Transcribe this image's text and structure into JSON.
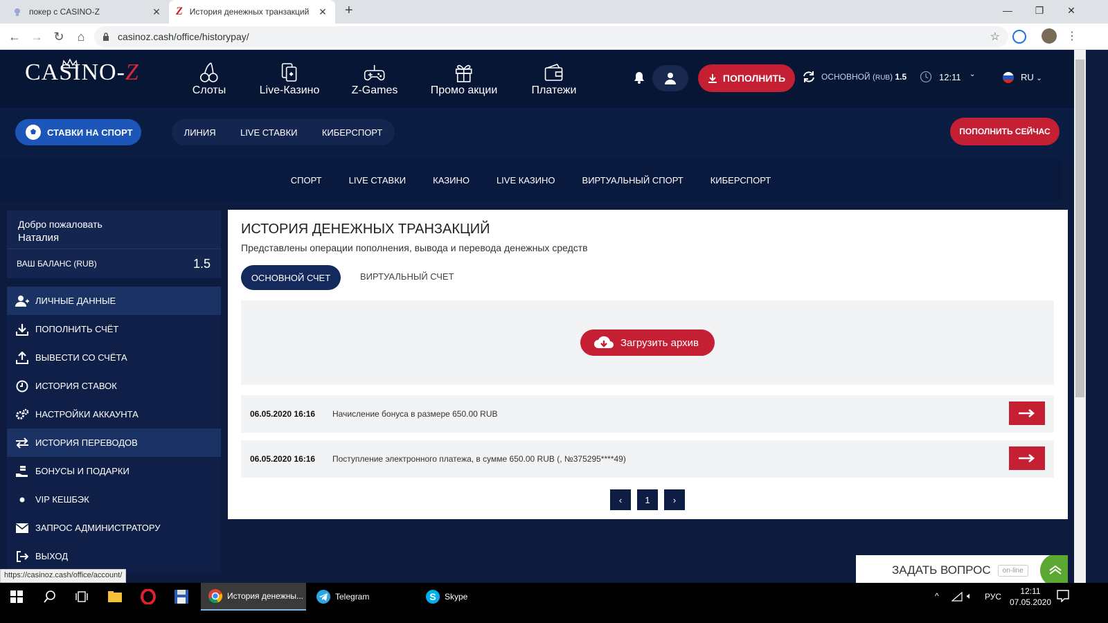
{
  "browser": {
    "tabs": [
      {
        "title": "покер с CASINO-Z"
      },
      {
        "title": "История денежных транзакций"
      }
    ],
    "url": "casinoz.cash/office/historypay/",
    "status_url": "https://casinoz.cash/office/account/"
  },
  "header": {
    "logo_text": "CASINO-",
    "logo_z": "Z",
    "nav": [
      {
        "label": "Слоты",
        "icon": "cherry-icon"
      },
      {
        "label": "Live-Казино",
        "icon": "cards-icon"
      },
      {
        "label": "Z-Games",
        "icon": "gamepad-icon"
      },
      {
        "label": "Промо акции",
        "icon": "gift-icon"
      },
      {
        "label": "Платежи",
        "icon": "wallet-icon"
      }
    ],
    "deposit_label": "ПОПОЛНИТЬ",
    "account_label": "ОСНОВНОЙ",
    "account_currency": "RUB",
    "account_balance": "1.5",
    "time": "12:11",
    "language": "RU"
  },
  "subnav": {
    "sports_label": "СТАВКИ НА СПОРТ",
    "links": [
      "ЛИНИЯ",
      "LIVE СТАВКИ",
      "КИБЕРСПОРТ"
    ],
    "deposit_now_label": "ПОПОЛНИТЬ СЕЙЧАС"
  },
  "categories": [
    "СПОРТ",
    "LIVE СТАВКИ",
    "КАЗИНО",
    "LIVE КАЗИНО",
    "ВИРТУАЛЬНЫЙ СПОРТ",
    "КИБЕРСПОРТ"
  ],
  "sidebar": {
    "welcome": "Добро пожаловать",
    "username": "Наталия",
    "balance_label": "ВАШ БАЛАНС (RUB)",
    "balance_value": "1.5",
    "menu": [
      {
        "label": "ЛИЧНЫЕ ДАННЫЕ",
        "icon": "user-add-icon"
      },
      {
        "label": "ПОПОЛНИТЬ СЧЁТ",
        "icon": "download-icon"
      },
      {
        "label": "ВЫВЕСТИ СО СЧЁТА",
        "icon": "upload-icon"
      },
      {
        "label": "ИСТОРИЯ СТАВОК",
        "icon": "clock-icon"
      },
      {
        "label": "НАСТРОЙКИ АККАУНТА",
        "icon": "gears-icon"
      },
      {
        "label": "ИСТОРИЯ ПЕРЕВОДОВ",
        "icon": "transfer-icon"
      },
      {
        "label": "БОНУСЫ И ПОДАРКИ",
        "icon": "hand-coin-icon"
      },
      {
        "label": "VIP КЕШБЭК",
        "icon": "dot-icon"
      },
      {
        "label": "ЗАПРОС АДМИНИСТРАТОРУ",
        "icon": "mail-icon"
      },
      {
        "label": "ВЫХОД",
        "icon": "logout-icon"
      }
    ]
  },
  "main": {
    "title": "ИСТОРИЯ ДЕНЕЖНЫХ ТРАНЗАКЦИЙ",
    "subtitle": "Представлены операции пополнения, вывода и перевода денежных средств",
    "tabs": [
      "ОСНОВНОЙ СЧЕТ",
      "ВИРТУАЛЬНЫЙ СЧЕТ"
    ],
    "archive_label": "Загрузить архив",
    "transactions": [
      {
        "date": "06.05.2020 16:16",
        "description": "Начисление бонуса в размере 650.00 RUB"
      },
      {
        "date": "06.05.2020 16:16",
        "description": "Поступление электронного платежа, в сумме 650.00 RUB (, №375295****49)"
      }
    ],
    "pagination": {
      "prev": "‹",
      "page": "1",
      "next": "›"
    }
  },
  "chat": {
    "label": "ЗАДАТЬ ВОПРОС",
    "status": "on-line"
  },
  "taskbar": {
    "apps": [
      {
        "label": "История денежны..."
      },
      {
        "label": "Telegram"
      },
      {
        "label": "Skype"
      }
    ],
    "lang": "РУС",
    "time": "12:11",
    "date": "07.05.2020"
  },
  "colors": {
    "accent_red": "#c51f33",
    "header_bg": "#071634",
    "sports_blue": "#1b56b8"
  }
}
